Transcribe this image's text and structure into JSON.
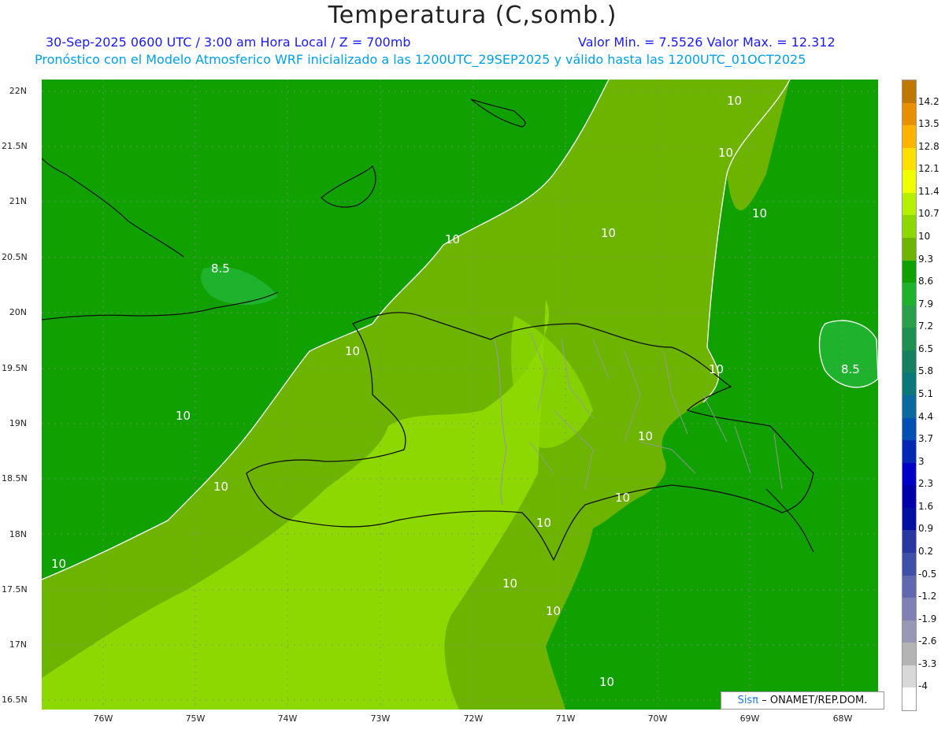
{
  "header": {
    "title": "Temperatura (C,somb.)",
    "line1_left": "30-Sep-2025  0600 UTC / 3:00 am Hora Local / Z = 700mb",
    "line1_right": "Valor Min. = 7.5526  Valor Max. = 12.312",
    "line2": "Pronóstico con el Modelo Atmosferico WRF inicializado a las 1200UTC_29SEP2025 y válido hasta las  1200UTC_01OCT2025"
  },
  "axes": {
    "y_labels": [
      "22N",
      "21.5N",
      "21N",
      "20.5N",
      "20N",
      "19.5N",
      "19N",
      "18.5N",
      "18N",
      "17.5N",
      "17N",
      "16.5N"
    ],
    "x_labels": [
      "76W",
      "75W",
      "74W",
      "73W",
      "72W",
      "71W",
      "70W",
      "69W",
      "68W"
    ]
  },
  "contour_labels": [
    "10",
    "10",
    "10",
    "10",
    "10",
    "10",
    "10",
    "10",
    "10",
    "10",
    "10",
    "10",
    "10",
    "10",
    "10",
    "10",
    "8.5",
    "8.5"
  ],
  "colorbar": {
    "labels": [
      "14.2",
      "13.5",
      "12.8",
      "12.1",
      "11.4",
      "10.7",
      "10",
      "9.3",
      "8.6",
      "7.9",
      "7.2",
      "6.5",
      "5.8",
      "5.1",
      "4.4",
      "3.7",
      "3",
      "2.3",
      "1.6",
      "0.9",
      "0.2",
      "-0.5",
      "-1.2",
      "-1.9",
      "-2.6",
      "-3.3",
      "-4"
    ],
    "colors": [
      "#c07800",
      "#e89000",
      "#ffb400",
      "#ffe000",
      "#f0ff00",
      "#b4f000",
      "#8cd800",
      "#6cb400",
      "#10a000",
      "#1fb22d",
      "#2aa04a",
      "#1e9050",
      "#168060",
      "#0a7878",
      "#0a6aa0",
      "#0050b4",
      "#0028b4",
      "#0000c8",
      "#0000aa",
      "#0010a0",
      "#2838a0",
      "#4050a8",
      "#6068b0",
      "#8080b4",
      "#9898b4",
      "#b4b4b4",
      "#d8d8d8",
      "#ffffff"
    ]
  },
  "credit": {
    "sis": "Sisπ",
    "rest": "– ONAMET/REP.DOM."
  }
}
